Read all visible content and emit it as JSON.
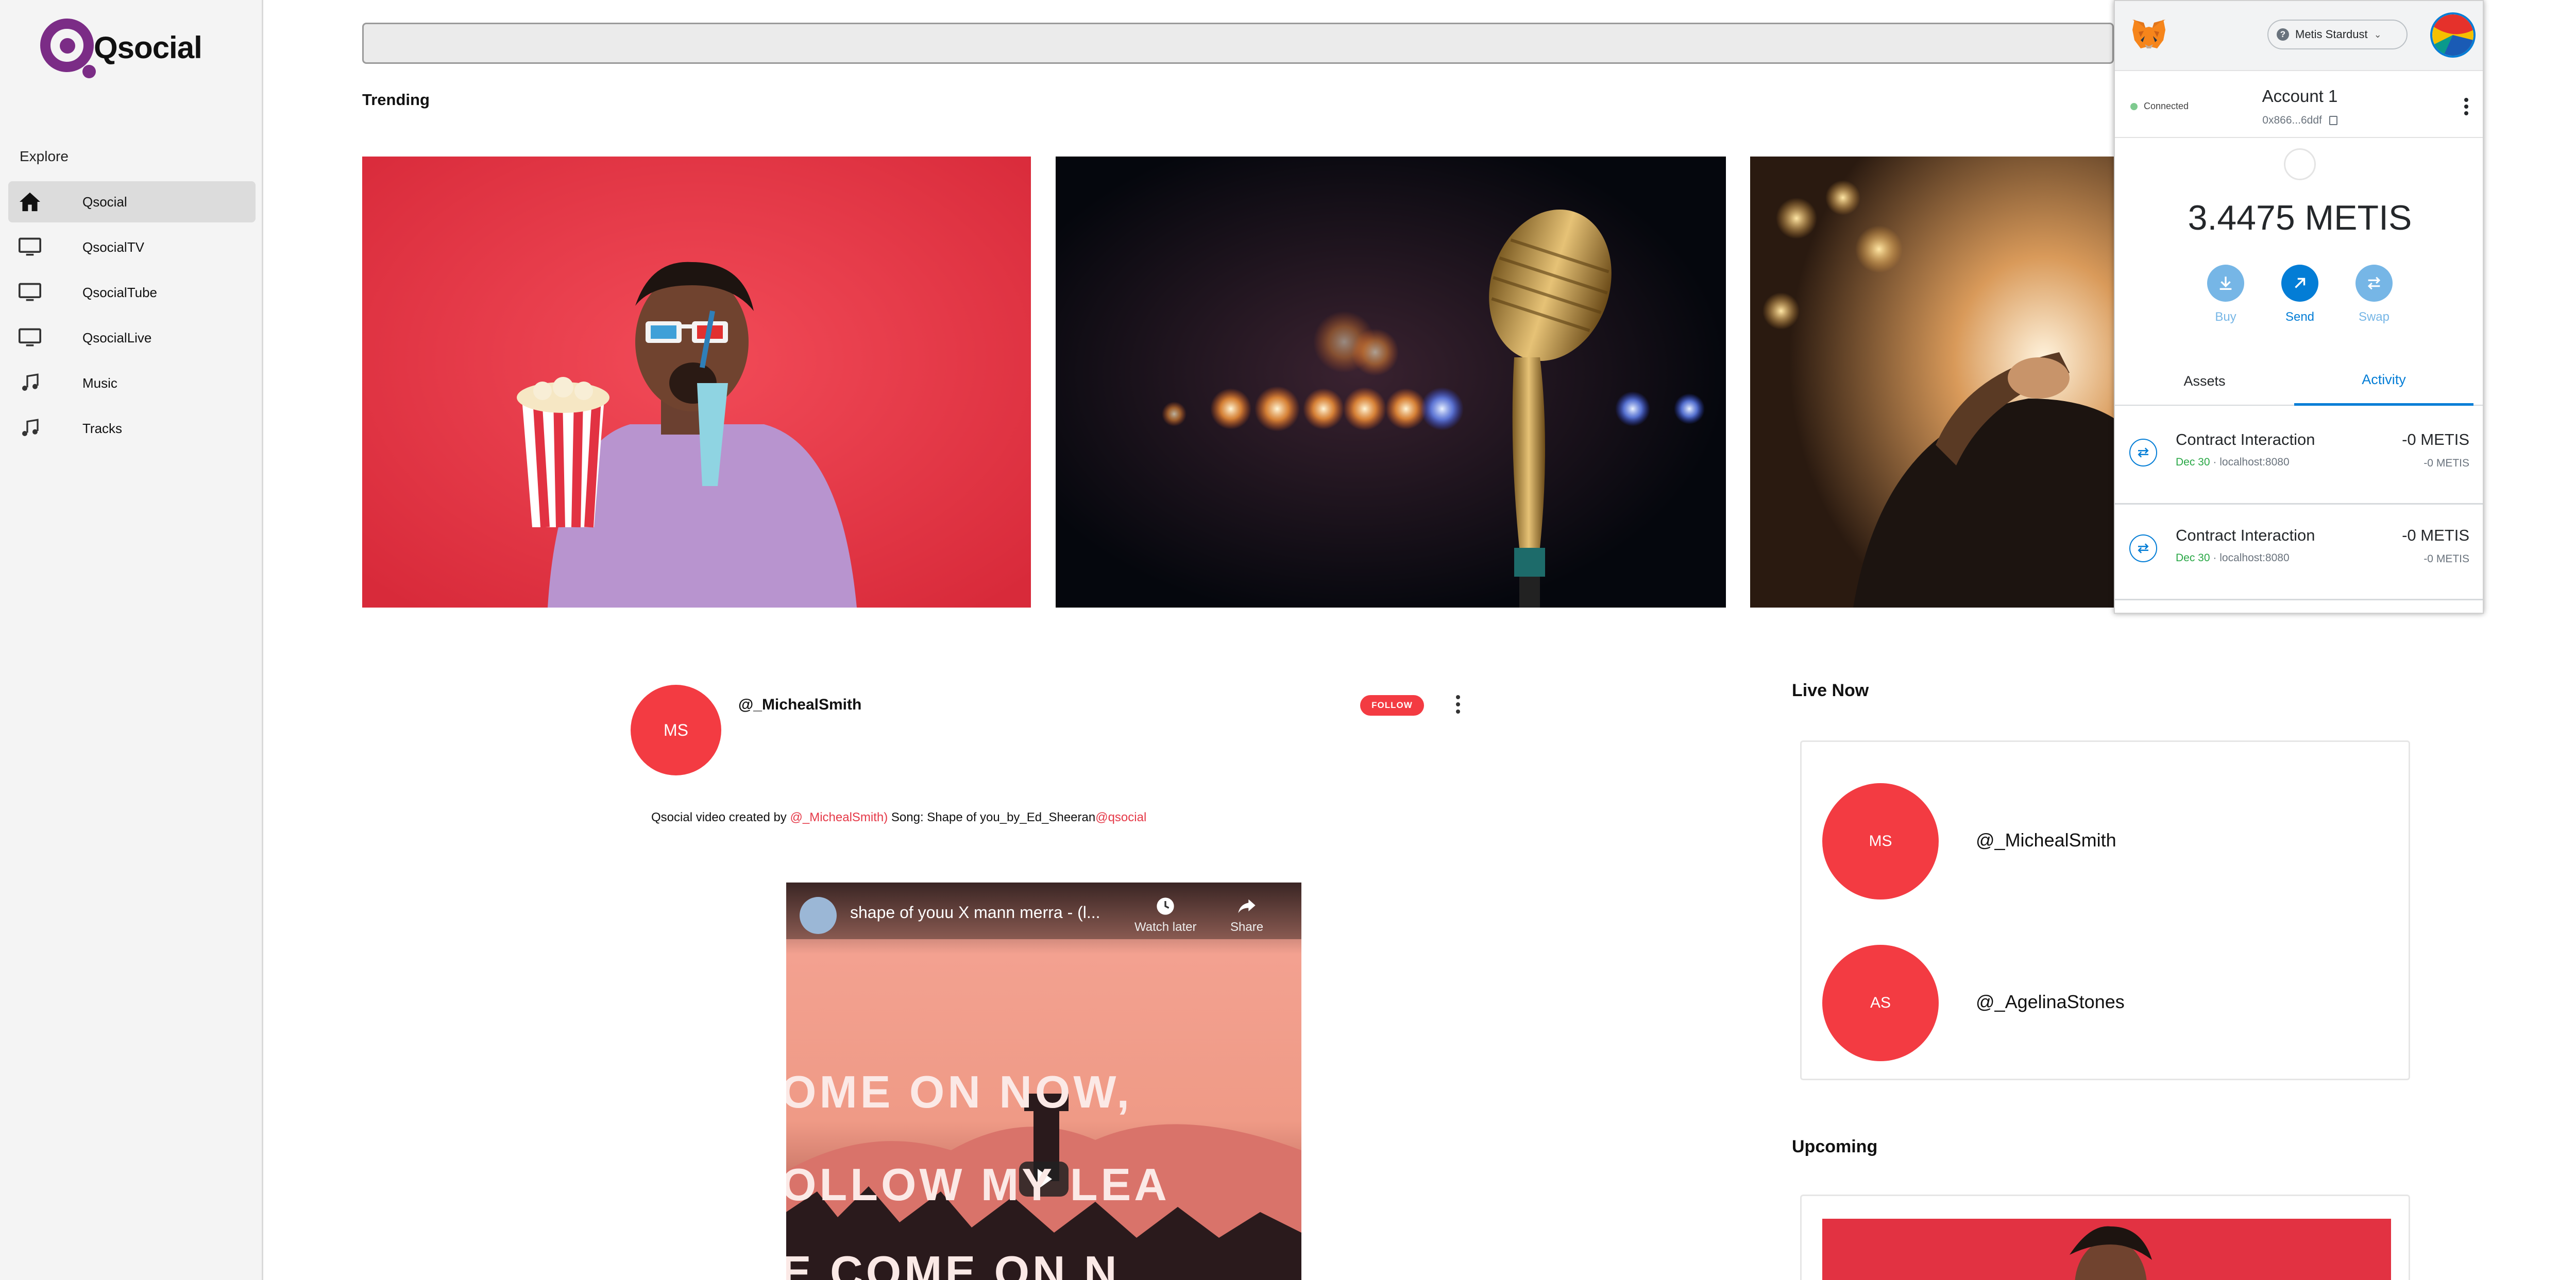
{
  "app": {
    "brand": "Qsocial",
    "colors": {
      "brand_purple": "#7b2c86",
      "accent_red": "#f33b42",
      "metamask_blue": "#037dd6",
      "sidebar_bg": "#f4f4f4"
    }
  },
  "sidebar": {
    "section_title": "Explore",
    "items": [
      {
        "label": "Qsocial",
        "icon": "home-icon",
        "active": true
      },
      {
        "label": "QsocialTV",
        "icon": "monitor-icon",
        "active": false
      },
      {
        "label": "QsocialTube",
        "icon": "monitor-icon",
        "active": false
      },
      {
        "label": "QsocialLive",
        "icon": "monitor-icon",
        "active": false
      },
      {
        "label": "Music",
        "icon": "music-note-icon",
        "active": false
      },
      {
        "label": "Tracks",
        "icon": "music-note-icon",
        "active": false
      }
    ]
  },
  "search": {
    "placeholder": ""
  },
  "trending": {
    "title": "Trending",
    "cards": [
      {
        "subject": "man-with-3d-glasses-popcorn"
      },
      {
        "subject": "vintage-microphone-stage-lights"
      },
      {
        "subject": "guitarist-stage-lights"
      }
    ]
  },
  "metamask": {
    "network": "Metis Stardust",
    "network_help": "?",
    "status": "Connected",
    "account_name": "Account 1",
    "account_address": "0x866...6ddf",
    "balance": "3.4475 METIS",
    "actions": [
      {
        "label": "Buy",
        "icon": "download-icon",
        "color": "#76b6e6"
      },
      {
        "label": "Send",
        "icon": "arrow-up-right-icon",
        "color": "#037dd6"
      },
      {
        "label": "Swap",
        "icon": "swap-icon",
        "color": "#76b6e6"
      }
    ],
    "tabs": [
      "Assets",
      "Activity"
    ],
    "active_tab": "Activity",
    "transactions": [
      {
        "title": "Contract Interaction",
        "date": "Dec 30",
        "origin": "localhost:8080",
        "amount": "-0 METIS",
        "amount_sub": "-0 METIS"
      },
      {
        "title": "Contract Interaction",
        "date": "Dec 30",
        "origin": "localhost:8080",
        "amount": "-0 METIS",
        "amount_sub": "-0 METIS"
      }
    ]
  },
  "post": {
    "avatar_initials": "MS",
    "username": "@_MichealSmith",
    "follow_label": "FOLLOW",
    "caption_prefix": "Qsocial video created by ",
    "caption_mention": "@_MichealSmith)",
    "caption_middle": " Song: Shape of you_by_Ed_Sheeran",
    "caption_tag": "@qsocial",
    "video": {
      "title": "shape of youu X mann merra - (l...",
      "watch_later": "Watch later",
      "share": "Share",
      "overlay_line1": "OME ON NOW,",
      "overlay_line2": "OLLOW MY LEA",
      "overlay_line3": "E  COME ON N"
    }
  },
  "live_now": {
    "title": "Live Now",
    "users": [
      {
        "initials": "MS",
        "name": "@_MichealSmith"
      },
      {
        "initials": "AS",
        "name": "@_AgelinaStones"
      }
    ]
  },
  "upcoming": {
    "title": "Upcoming"
  }
}
